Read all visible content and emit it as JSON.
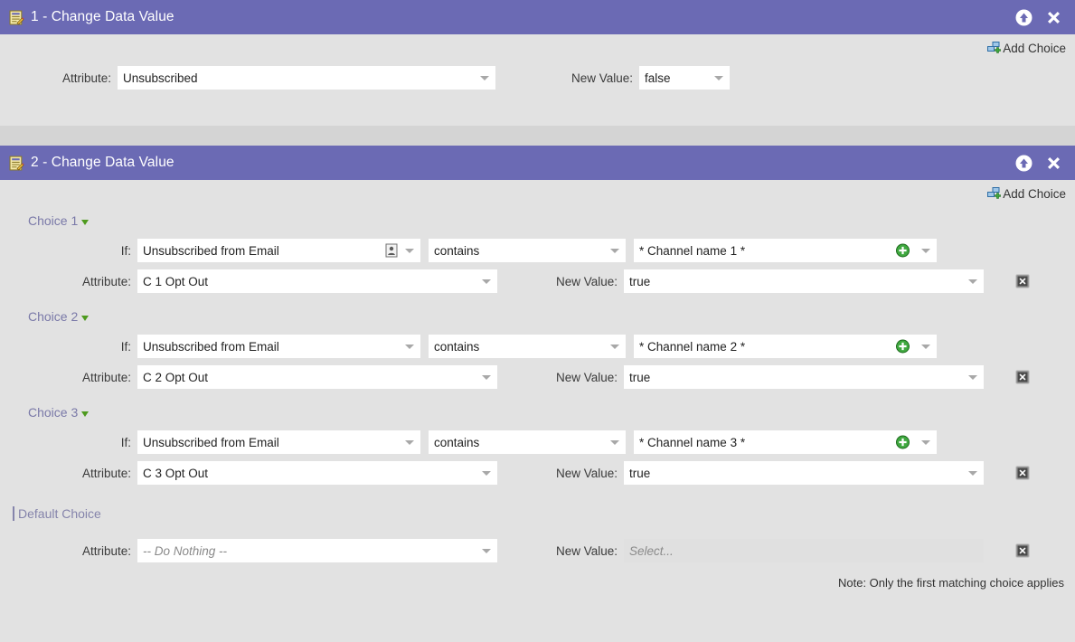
{
  "theme": {
    "header_bg": "#6b6ab4",
    "page_bg": "#e2e2e2",
    "separator_bg": "#d4d4d4",
    "choice_link": "#7a79a8",
    "green_accent": "#4e9a1e"
  },
  "panel1": {
    "icon": "notepad-pencil-icon",
    "title": "1 - Change Data Value",
    "collapse_icon": "up-arrow-circle-icon",
    "close_icon": "close-x-icon",
    "add_choice": {
      "icon": "add-choice-icon",
      "label": "Add Choice"
    },
    "attribute_label": "Attribute:",
    "attribute_value": "Unsubscribed",
    "new_value_label": "New Value:",
    "new_value": "false"
  },
  "panel2": {
    "icon": "notepad-pencil-icon",
    "title": "2 - Change Data Value",
    "collapse_icon": "up-arrow-circle-icon",
    "close_icon": "close-x-icon",
    "add_choice": {
      "icon": "add-choice-icon",
      "label": "Add Choice"
    },
    "labels": {
      "if": "If:",
      "attribute": "Attribute:",
      "new_value": "New Value:"
    },
    "choices": [
      {
        "name": "Choice 1",
        "if_field": "Unsubscribed from Email",
        "if_field_icon": "contact-card-icon",
        "operator": "contains",
        "compare_value": "* Channel name 1 *",
        "compare_value_icon": "green-plus-icon",
        "attribute": "C 1  Opt Out",
        "new_value": "true",
        "delete_icon": "delete-x-icon"
      },
      {
        "name": "Choice 2",
        "if_field": "Unsubscribed from Email",
        "if_field_icon": "",
        "operator": "contains",
        "compare_value": "* Channel name 2 *",
        "compare_value_icon": "green-plus-icon",
        "attribute": "C 2  Opt Out",
        "new_value": "true",
        "delete_icon": "delete-x-icon"
      },
      {
        "name": "Choice 3",
        "if_field": "Unsubscribed from Email",
        "if_field_icon": "",
        "operator": "contains",
        "compare_value": "* Channel name 3 *",
        "compare_value_icon": "green-plus-icon",
        "attribute": "C 3  Opt Out",
        "new_value": "true",
        "delete_icon": "delete-x-icon"
      }
    ],
    "default_choice": {
      "name": "Default Choice",
      "attribute_label": "Attribute:",
      "attribute_value": "-- Do Nothing --",
      "new_value_label": "New Value:",
      "new_value_placeholder": "Select...",
      "delete_icon": "delete-x-icon"
    },
    "note": "Note: Only the first matching choice applies"
  }
}
